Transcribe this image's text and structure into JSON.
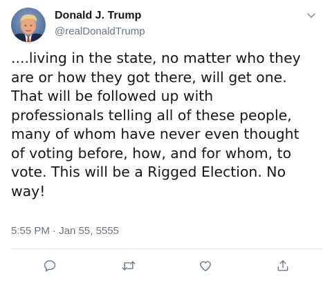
{
  "tweet": {
    "author_name": "Donald J. Trump",
    "author_handle": "@realDonaldTrump",
    "text": "....living in the state, no matter who they\nare or how they got there, will get one.\nThat will be followed up with\nprofessionals telling all of these people,\nmany of whom have never even thought\nof voting before, how, and for whom, to\nvote. This will be a Rigged Election. No\nway!",
    "timestamp": "5:55 PM · Jan 55, 5555"
  },
  "icons": {
    "menu": "chevron-down-icon",
    "reply": "reply-icon",
    "retweet": "retweet-icon",
    "like": "heart-icon",
    "share": "share-icon"
  },
  "colors": {
    "text": "#14171a",
    "secondary": "#657786",
    "divider": "#e1e8ed"
  }
}
